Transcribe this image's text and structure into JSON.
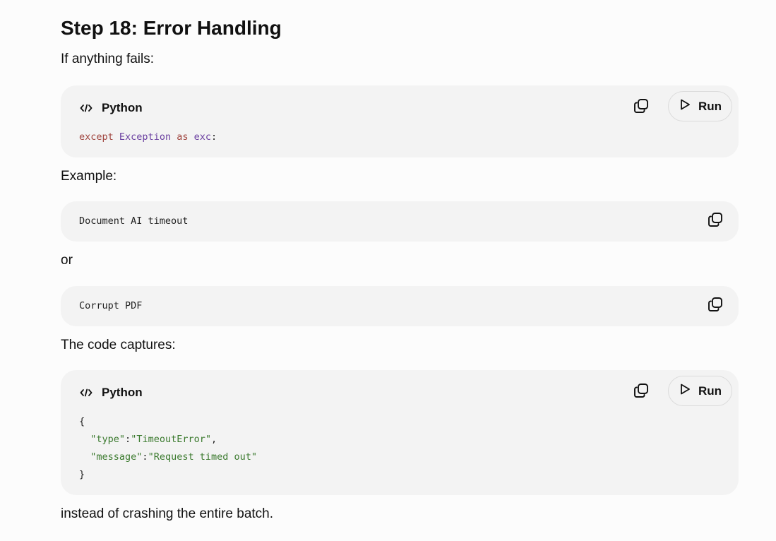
{
  "heading": "Step 18: Error Handling",
  "paragraphs": {
    "intro": "If anything fails:",
    "example": "Example:",
    "or": "or",
    "captures": "The code captures:",
    "outro": "instead of crashing the entire batch."
  },
  "code_blocks": [
    {
      "language": "Python",
      "run_label": "Run",
      "tokens": {
        "except": "except",
        "space1": " ",
        "exception": "Exception",
        "space2": " ",
        "as": "as",
        "space3": " ",
        "exc": "exc",
        "colon": ":"
      }
    },
    {
      "text": "Document AI timeout"
    },
    {
      "text": "Corrupt PDF"
    },
    {
      "language": "Python",
      "run_label": "Run",
      "tokens": {
        "open_brace": "{",
        "indent1": "  ",
        "type_key": "\"type\"",
        "colon1": ":",
        "type_val": "\"TimeoutError\"",
        "comma1": ",",
        "indent2": "  ",
        "message_key": "\"message\"",
        "colon2": ":",
        "message_val": "\"Request timed out\"",
        "close_brace": "}"
      }
    }
  ],
  "icons": {
    "language": "code-icon",
    "copy": "copy-icon",
    "run": "play-icon"
  },
  "colors": {
    "background": "#fcfcfc",
    "code_background": "#f3f3f3",
    "keyword": "#a0453f",
    "class_name": "#6a3fa0",
    "string": "#3b7a2e"
  }
}
